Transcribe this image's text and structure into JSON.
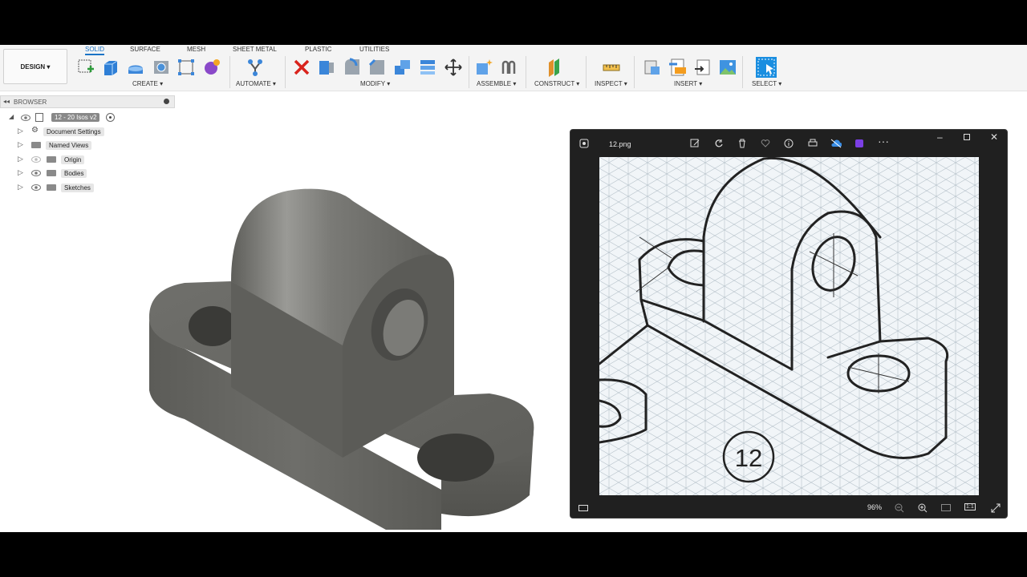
{
  "toolbar": {
    "design_label": "DESIGN ▾",
    "tabs": [
      "SOLID",
      "SURFACE",
      "MESH",
      "SHEET METAL",
      "PLASTIC",
      "UTILITIES"
    ],
    "groups": {
      "create": "CREATE ▾",
      "automate": "AUTOMATE ▾",
      "modify": "MODIFY ▾",
      "assemble": "ASSEMBLE ▾",
      "construct": "CONSTRUCT ▾",
      "inspect": "INSPECT ▾",
      "insert": "INSERT ▾",
      "select": "SELECT ▾"
    }
  },
  "browser": {
    "title": "BROWSER",
    "root": "12 - 20 Isos v2",
    "items": [
      "Document Settings",
      "Named Views",
      "Origin",
      "Bodies",
      "Sketches"
    ]
  },
  "viewer": {
    "filename": "12.png",
    "zoom": "96%",
    "figure_number": "12"
  },
  "colors": {
    "accent": "#1a73c6",
    "part_gray": "#6e6e6a",
    "viewer_bg": "#202020"
  }
}
